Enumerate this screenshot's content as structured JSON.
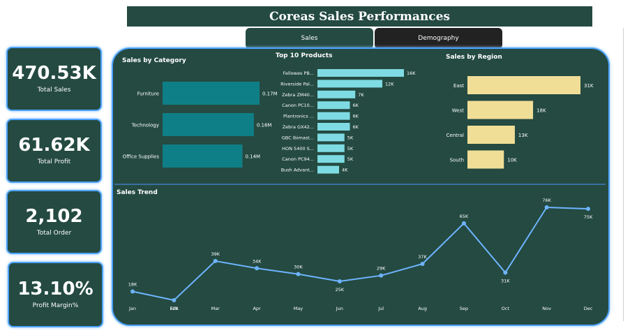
{
  "header": {
    "title": "Coreas Sales Performances"
  },
  "tabs": [
    {
      "label": "Sales",
      "active": true
    },
    {
      "label": "Demography",
      "active": false
    }
  ],
  "kpis": [
    {
      "value": "470.53K",
      "label": "Total Sales"
    },
    {
      "value": "61.62K",
      "label": "Total Profit"
    },
    {
      "value": "2,102",
      "label": "Total Order"
    },
    {
      "value": "13.10%",
      "label": "Profit Margin%"
    }
  ],
  "colors": {
    "background": "#ffffff",
    "panel": "#244a41",
    "accent_border": "#4da3ff",
    "category_bar": "#0f7f87",
    "product_bar": "#7fdbe3",
    "region_bar": "#f0de97",
    "trend_line": "#6eb4ff",
    "tab_inactive": "#222222"
  },
  "chart_data": [
    {
      "type": "bar",
      "orientation": "horizontal",
      "title": "Sales by Category",
      "categories": [
        "Furniture",
        "Technology",
        "Office Supplies"
      ],
      "values": [
        0.17,
        0.16,
        0.14
      ],
      "value_labels": [
        "0.17M",
        "0.16M",
        "0.14M"
      ],
      "color": "#0f7f87"
    },
    {
      "type": "bar",
      "orientation": "horizontal",
      "title": "Top 10 Products",
      "categories": [
        "Fellowes PB...",
        "Riverside Pal...",
        "Zebra ZM40...",
        "Canon PC10...",
        "Plantronics ...",
        "Zebra GX42...",
        "GBC Ibimast...",
        "HON 5400 S...",
        "Canon PC94...",
        "Bush Advant..."
      ],
      "values": [
        16,
        12,
        7,
        6,
        6,
        6,
        5,
        5,
        5,
        4
      ],
      "value_labels": [
        "16K",
        "12K",
        "7K",
        "6K",
        "6K",
        "6K",
        "5K",
        "5K",
        "5K",
        "4K"
      ],
      "color": "#7fdbe3"
    },
    {
      "type": "bar",
      "orientation": "horizontal",
      "title": "Sales by Region",
      "categories": [
        "East",
        "West",
        "Central",
        "South"
      ],
      "values": [
        31,
        18,
        13,
        10
      ],
      "value_labels": [
        "31K",
        "18K",
        "13K",
        "10K"
      ],
      "color": "#f0de97"
    },
    {
      "type": "line",
      "title": "Sales Trend",
      "categories": [
        "Jan",
        "Feb",
        "Mar",
        "Apr",
        "May",
        "Jun",
        "Jul",
        "Aug",
        "Sep",
        "Oct",
        "Nov",
        "Dec"
      ],
      "values": [
        18,
        12,
        39,
        34,
        30,
        25,
        29,
        37,
        65,
        31,
        76,
        75
      ],
      "value_labels": [
        "18K",
        "12K",
        "39K",
        "34K",
        "30K",
        "25K",
        "29K",
        "37K",
        "65K",
        "31K",
        "76K",
        "75K"
      ],
      "ylim": [
        12,
        76
      ],
      "color": "#6eb4ff"
    }
  ]
}
